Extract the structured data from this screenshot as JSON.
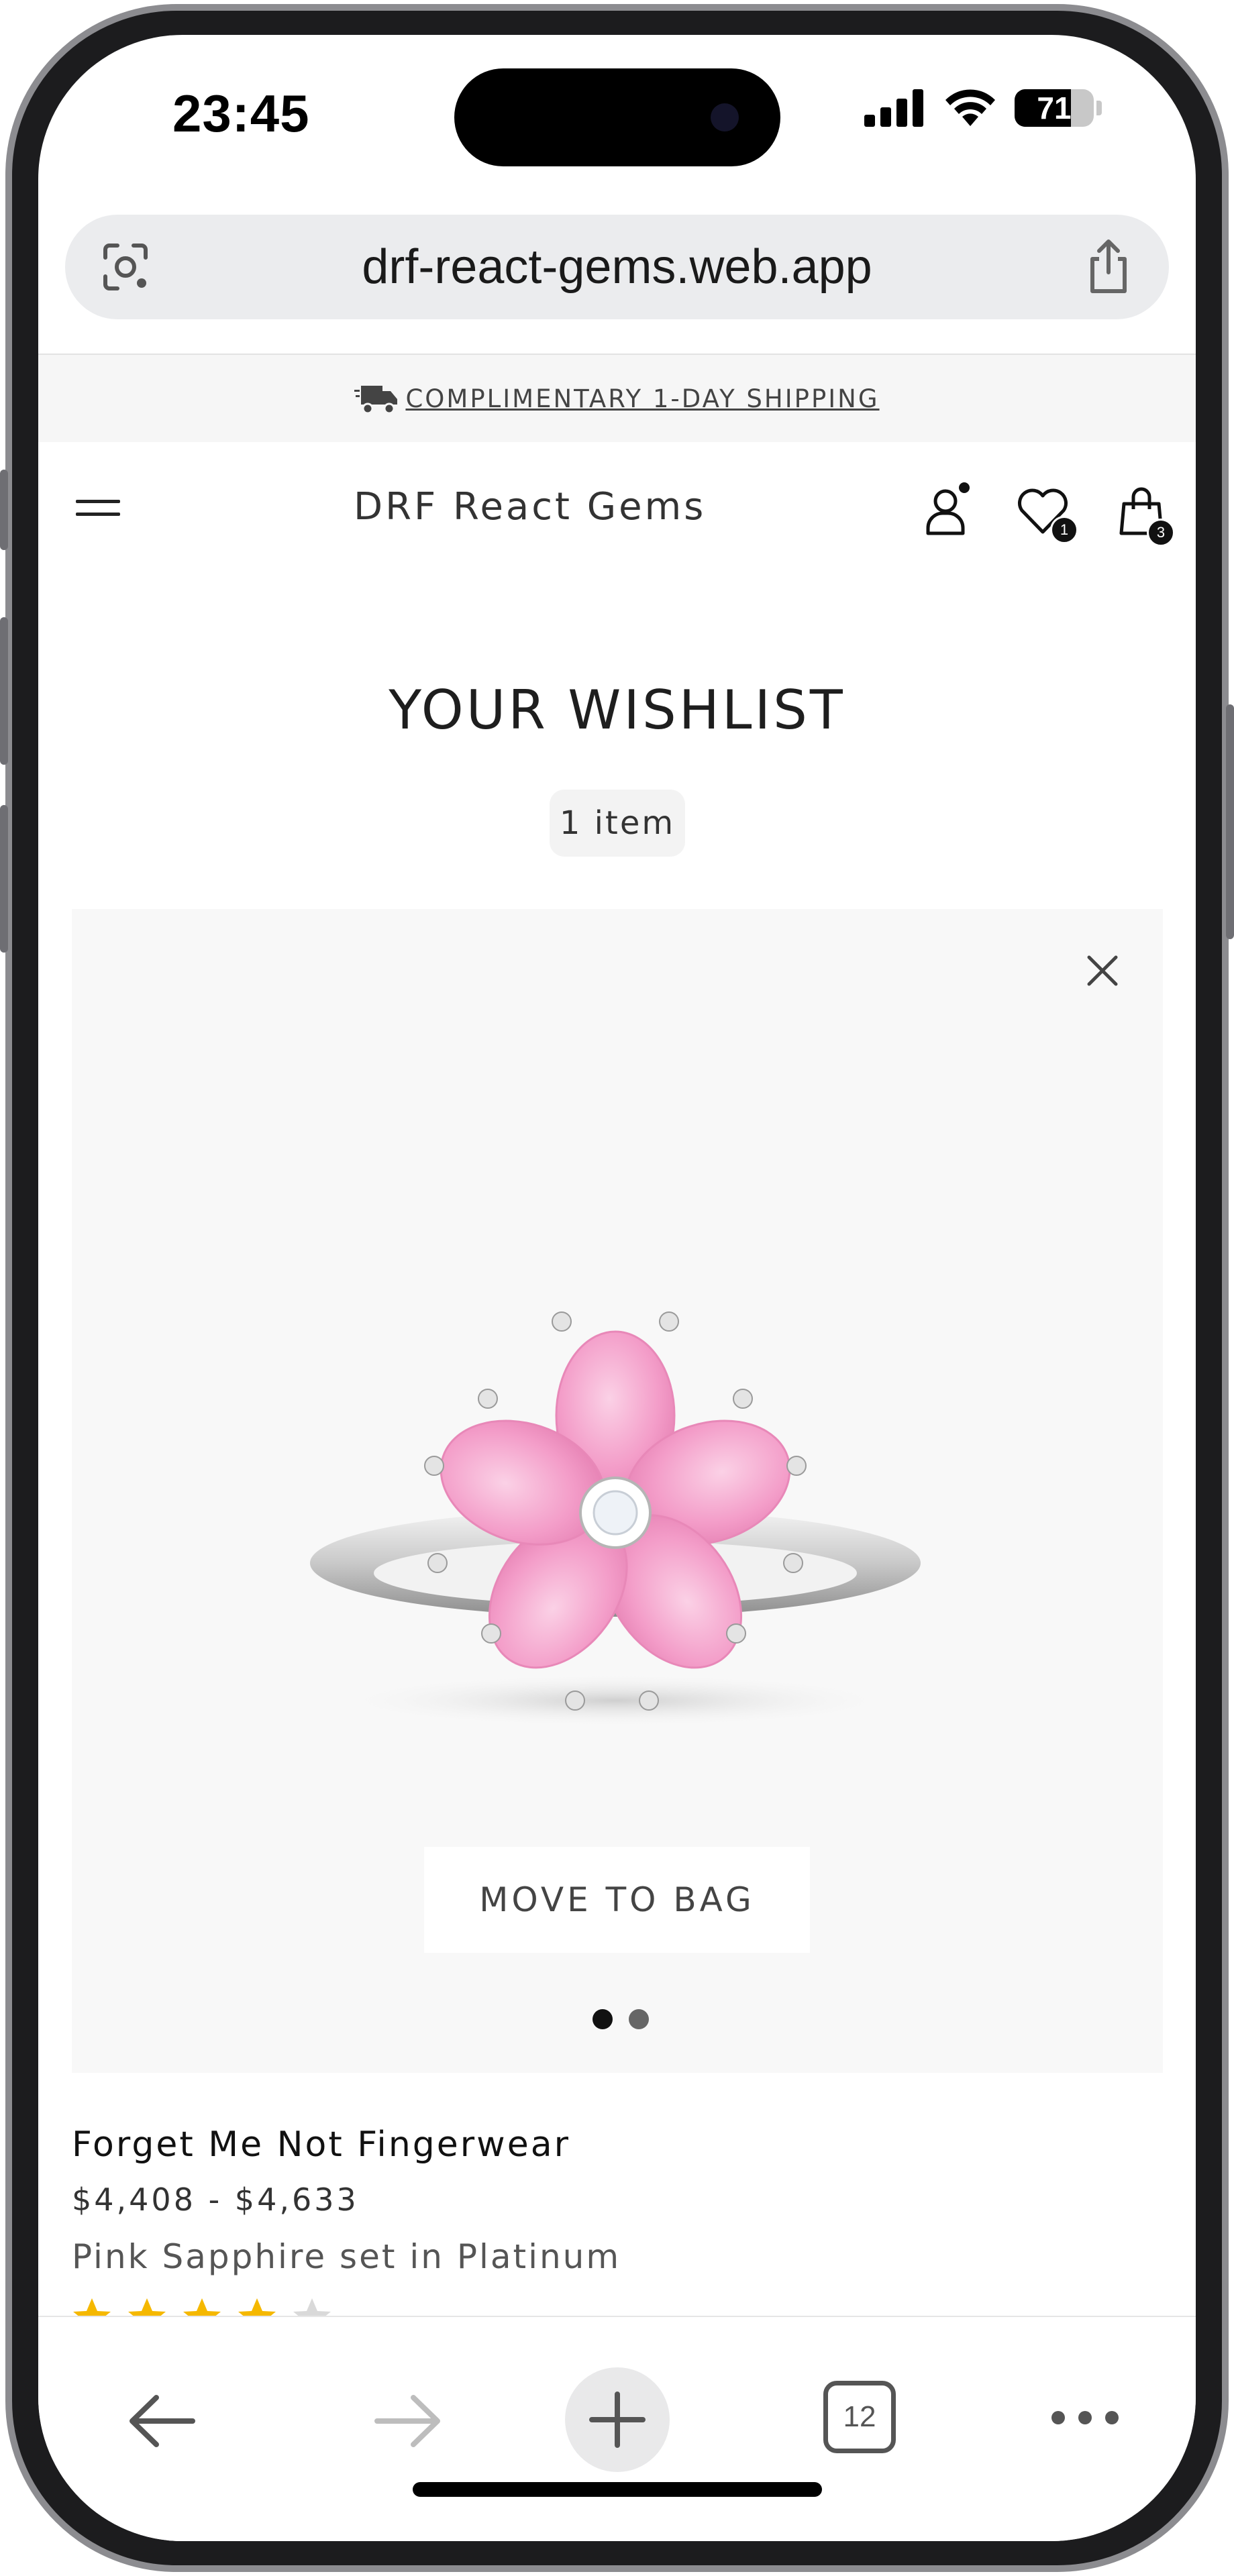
{
  "status_bar": {
    "time": "23:45",
    "battery_level": "71",
    "battery_fraction": 0.71
  },
  "browser": {
    "url": "drf-react-gems.web.app",
    "tab_count": "12"
  },
  "site": {
    "announcement": "COMPLIMENTARY 1-DAY SHIPPING",
    "brand": "DRF React Gems",
    "wishlist_badge": "1",
    "bag_badge": "3"
  },
  "wishlist": {
    "title": "YOUR WISHLIST",
    "count_label": "1 item",
    "items": [
      {
        "name": "Forget Me Not Fingerwear",
        "price": "$4,408 - $4,633",
        "description": "Pink Sapphire set in Platinum",
        "rating": 4,
        "rating_max": 5,
        "move_label": "MOVE TO BAG",
        "image_count": 2,
        "active_image": 0
      }
    ]
  },
  "colors": {
    "star": "#f5b800",
    "star_empty": "#d9d9d9",
    "sapphire": "#f39cc8"
  }
}
